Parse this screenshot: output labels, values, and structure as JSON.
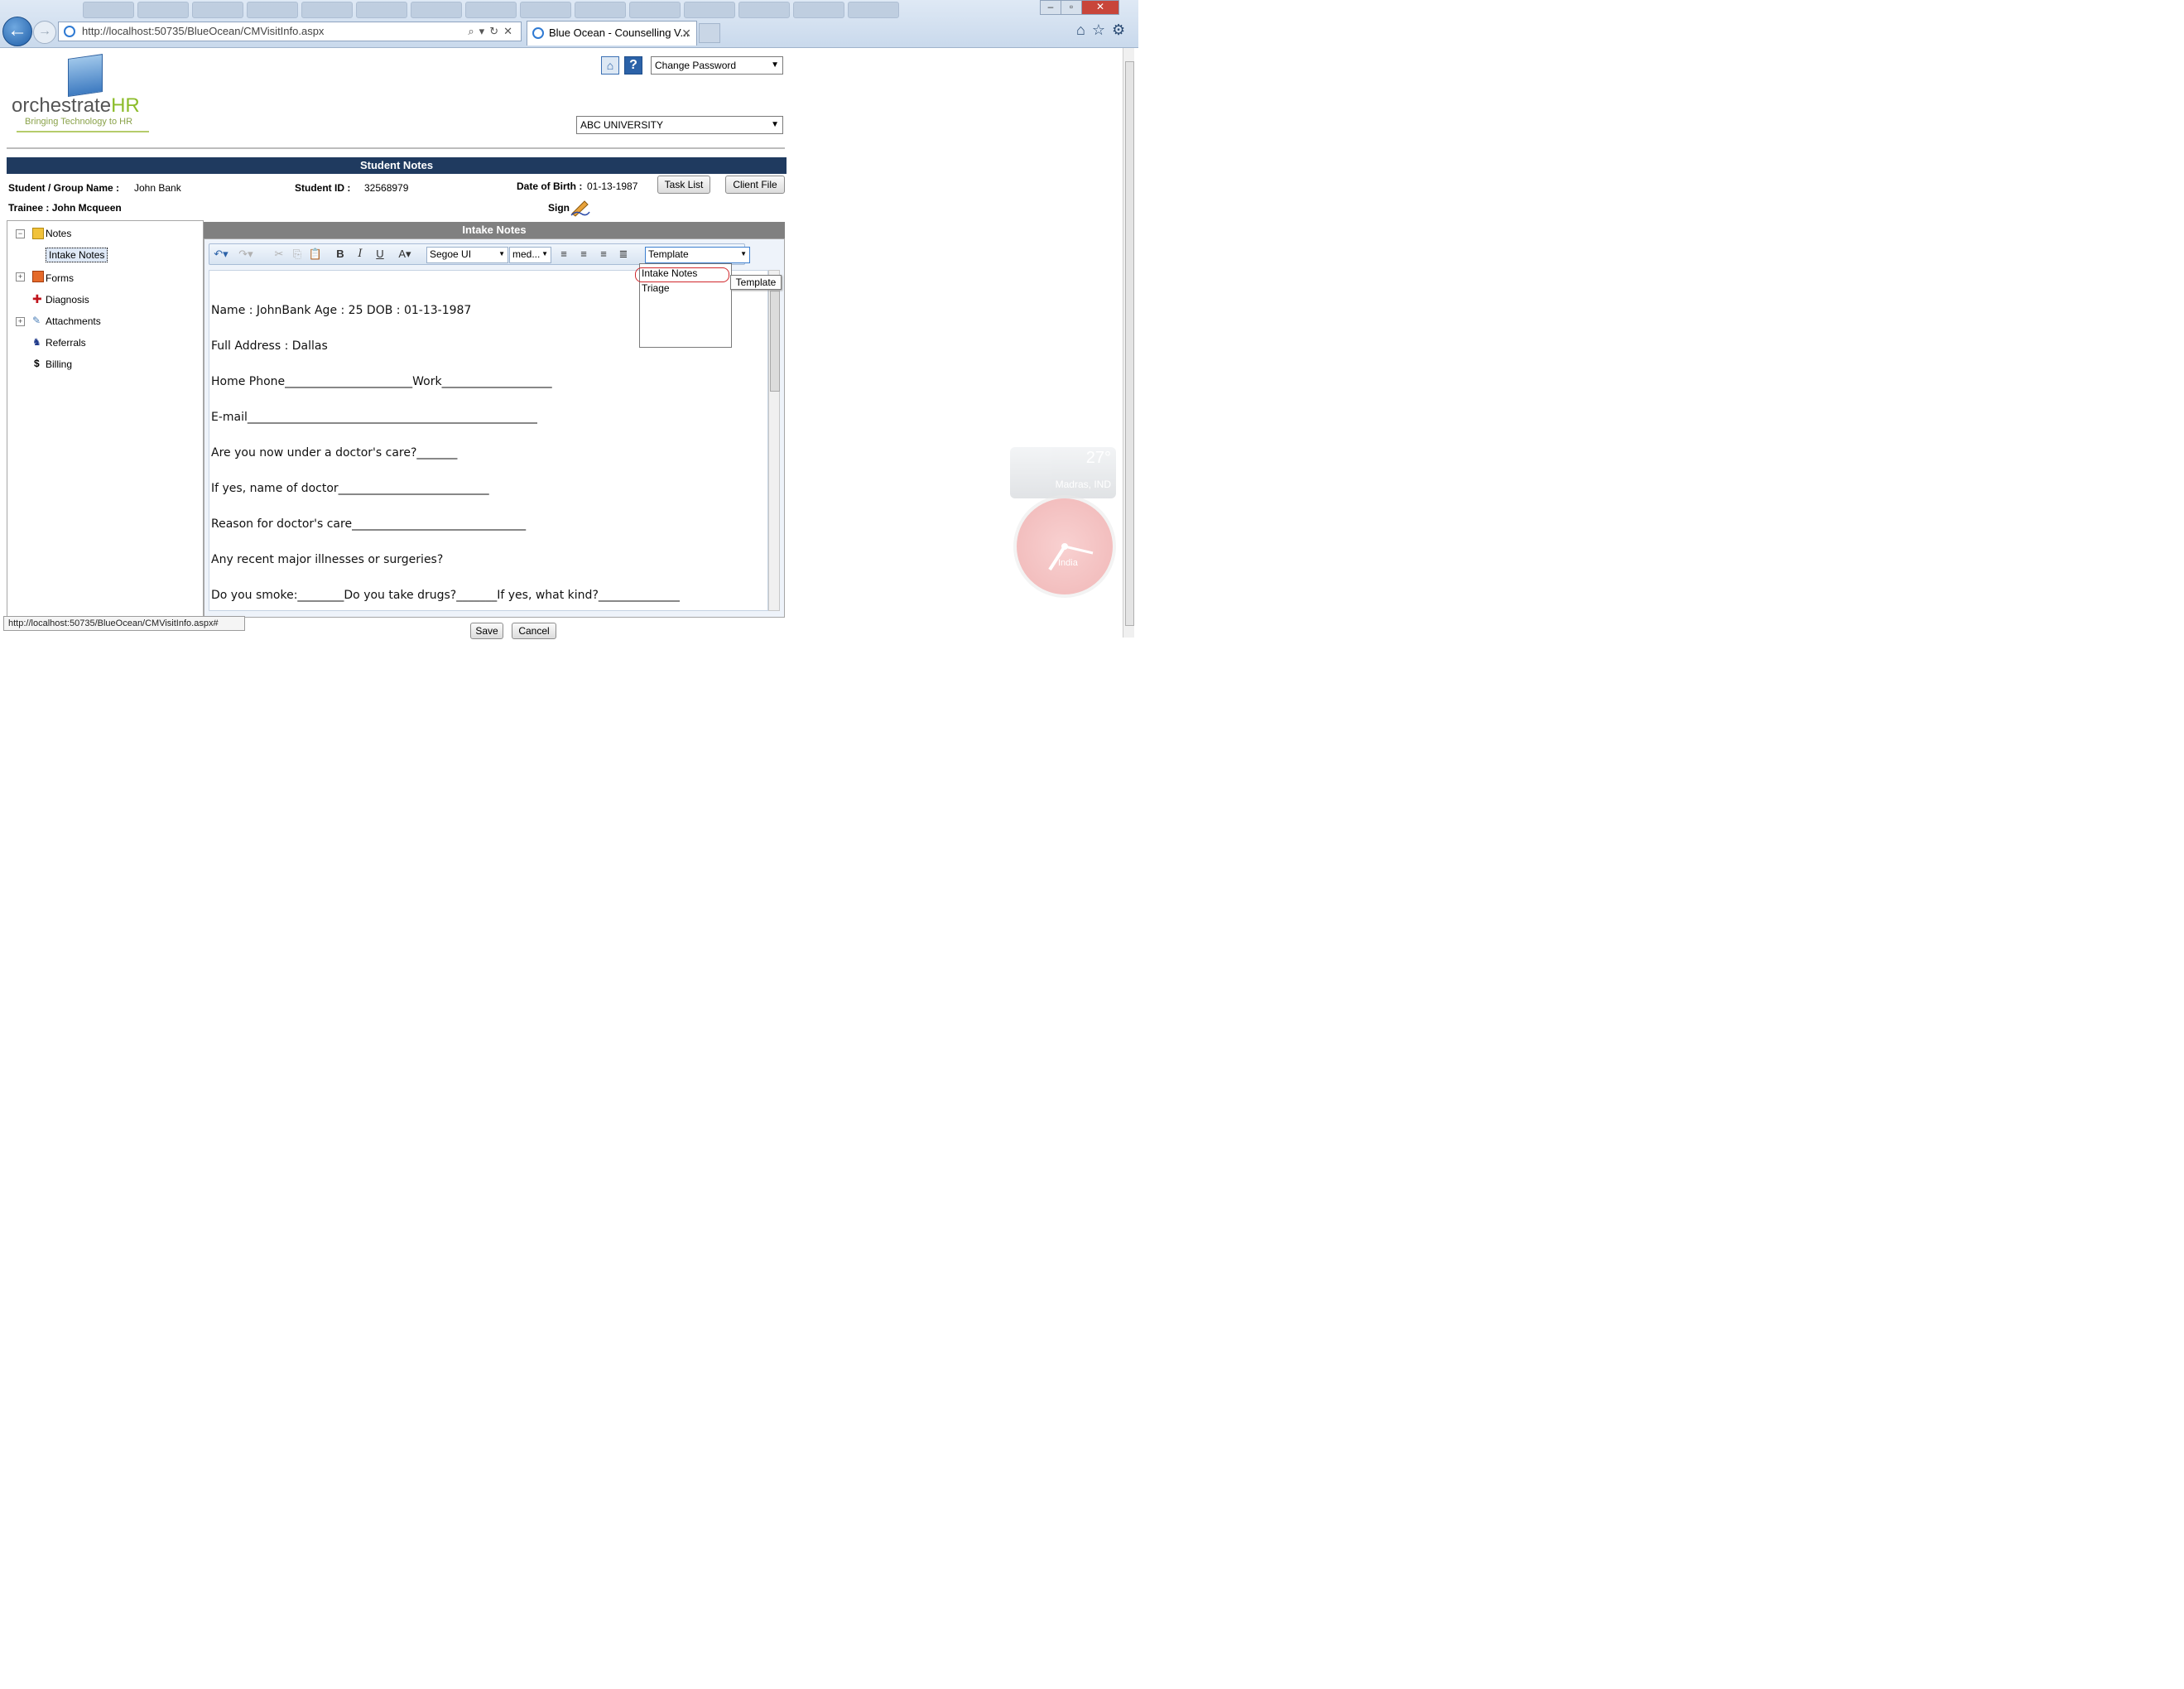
{
  "browser": {
    "address_url": "http://localhost:50735/BlueOcean/CMVisitInfo.aspx",
    "active_tab_title": "Blue Ocean - Counselling V...",
    "status_url": "http://localhost:50735/BlueOcean/CMVisitInfo.aspx#"
  },
  "header": {
    "logo_text_main": "orchestrate",
    "logo_text_accent": "HR",
    "logo_tagline": "Bringing Technology to HR",
    "password_select_value": "Change Password",
    "organization_select_value": "ABC UNIVERSITY"
  },
  "student_notes": {
    "title": "Student Notes",
    "student_label": "Student / Group Name :",
    "student_value": "John Bank",
    "id_label": "Student ID :",
    "id_value": "32568979",
    "dob_label": "Date of Birth :",
    "dob_value": "01-13-1987",
    "task_list_button": "Task List",
    "client_file_button": "Client File",
    "trainee_label": "Trainee : John Mcqueen",
    "sign_label": "Sign"
  },
  "tree": {
    "items": [
      {
        "label": "Notes",
        "icon": "notes-icon"
      },
      {
        "label": "Intake Notes",
        "icon": "none"
      },
      {
        "label": "Forms",
        "icon": "forms-icon"
      },
      {
        "label": "Diagnosis",
        "icon": "cross-icon"
      },
      {
        "label": "Attachments",
        "icon": "paperclip-icon"
      },
      {
        "label": "Referrals",
        "icon": "referrals-icon"
      },
      {
        "label": "Billing",
        "icon": "dollar-icon"
      }
    ]
  },
  "editor": {
    "title": "Intake Notes",
    "font_family_value": "Segoe UI",
    "font_size_value": "med...",
    "template_value": "Template",
    "template_options": [
      "Intake Notes",
      "Triage"
    ],
    "tooltip": "Template",
    "lines": [
      " Name : JohnBank Age : 25 DOB : 01-13-1987",
      "Full Address : Dallas",
      "Home Phone______________________Work___________________",
      "E-mail__________________________________________________",
      "Are you now under a doctor's care?_______",
      "If yes, name of doctor__________________________",
      "Reason for doctor's care______________________________",
      "Any recent major illnesses or surgeries?",
      "Do you smoke:________Do you take drugs?_______If yes, what kind?______________"
    ]
  },
  "footer": {
    "save_button": "Save",
    "cancel_button": "Cancel"
  },
  "desktop": {
    "weather_temp": "27°",
    "weather_location": "Madras, IND",
    "clock_label": "India"
  }
}
